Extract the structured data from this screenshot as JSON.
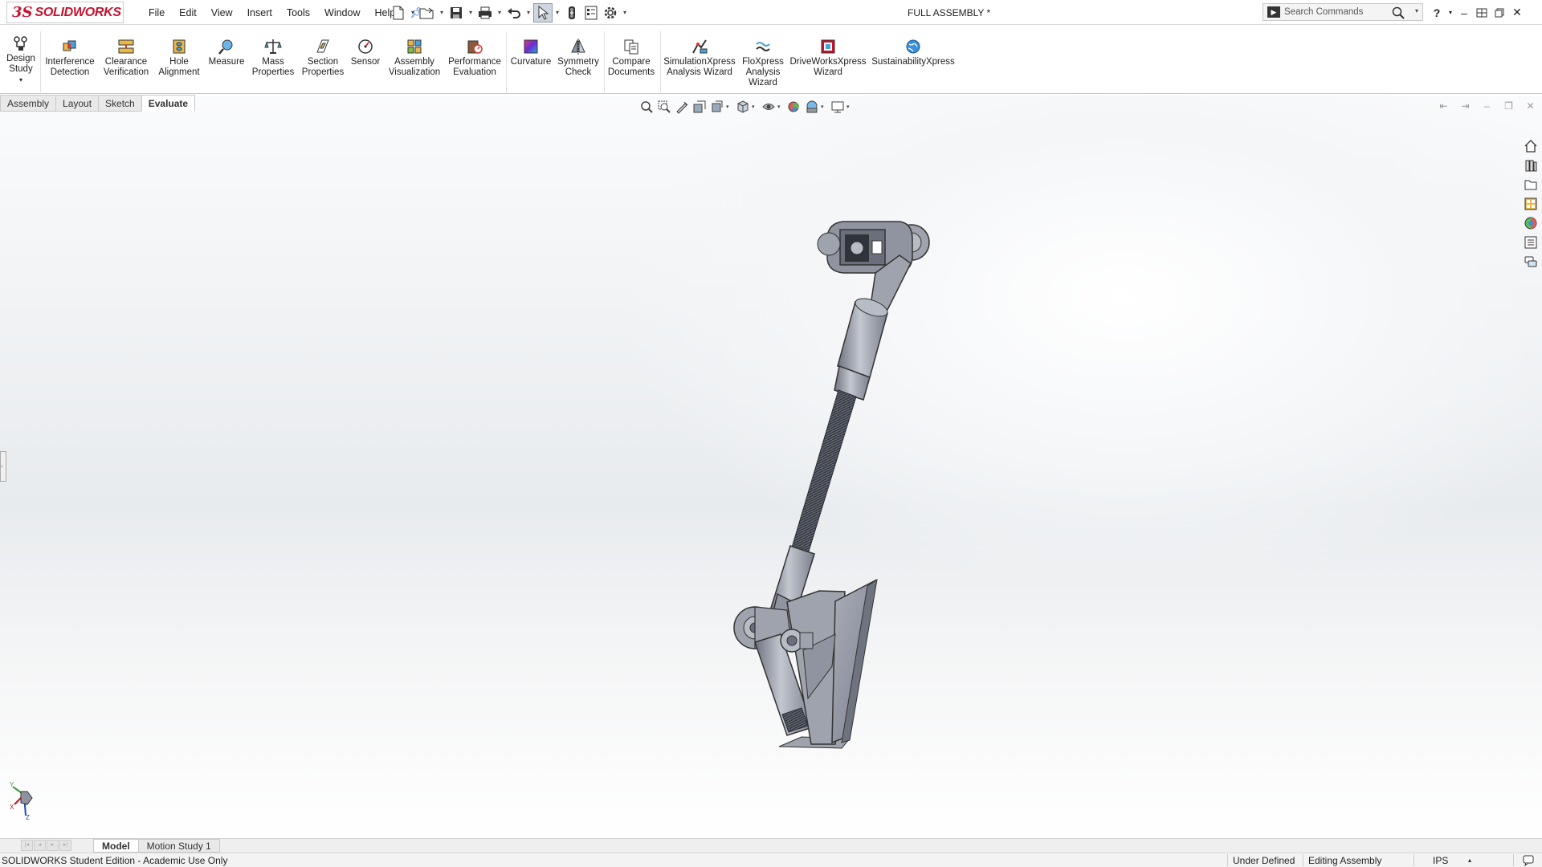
{
  "app": {
    "logo_ds": "3S",
    "logo_text": "SOLIDWORKS",
    "doc_title": "FULL ASSEMBLY *"
  },
  "menu": [
    "File",
    "Edit",
    "View",
    "Insert",
    "Tools",
    "Window",
    "Help"
  ],
  "search": {
    "placeholder": "Search Commands"
  },
  "command_manager": {
    "design_study": "Design\nStudy",
    "interference": "Interference\nDetection",
    "clearance": "Clearance\nVerification",
    "hole": "Hole\nAlignment",
    "measure": "Measure",
    "mass": "Mass\nProperties",
    "section": "Section\nProperties",
    "sensor": "Sensor",
    "assembly_vis": "Assembly\nVisualization",
    "performance": "Performance\nEvaluation",
    "curvature": "Curvature",
    "symmetry": "Symmetry\nCheck",
    "compare": "Compare\nDocuments",
    "simxpress": "SimulationXpress\nAnalysis Wizard",
    "floxpress": "FloXpress\nAnalysis\nWizard",
    "driveworks": "DriveWorksXpress\nWizard",
    "sustain": "SustainabilityXpress"
  },
  "tabs": [
    "Assembly",
    "Layout",
    "Sketch",
    "Evaluate"
  ],
  "active_tab": "Evaluate",
  "bottom_tabs": [
    "Model",
    "Motion Study 1"
  ],
  "status": {
    "edition": "SOLIDWORKS Student Edition - Academic Use Only",
    "defined": "Under Defined",
    "editing": "Editing Assembly",
    "units": "IPS"
  },
  "colors": {
    "brand_red": "#c8102e",
    "model_gray": "#9ea3ad"
  }
}
